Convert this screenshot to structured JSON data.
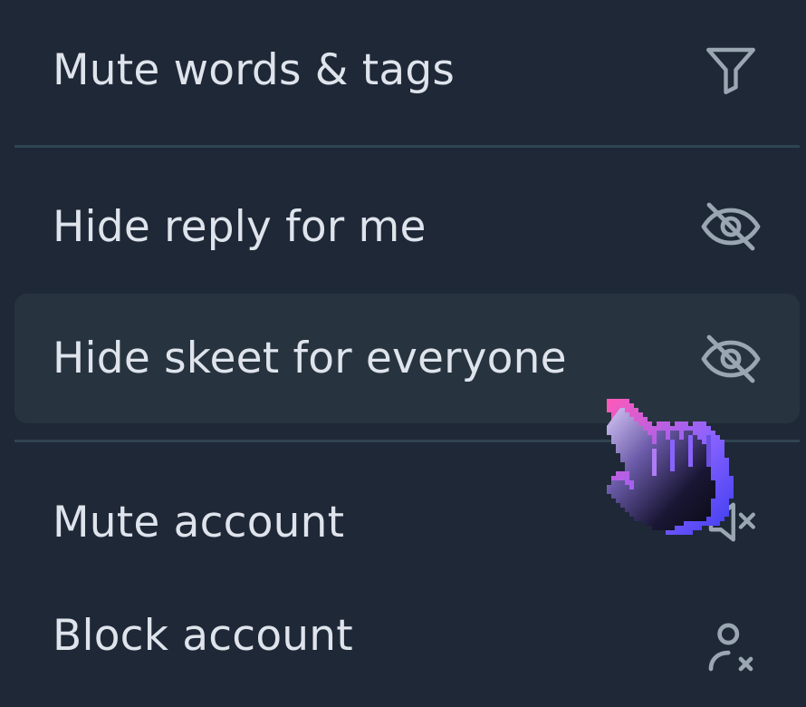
{
  "menu": {
    "items": [
      {
        "label": "Mute words & tags",
        "icon": "filter-icon"
      },
      {
        "label": "Hide reply for me",
        "icon": "eye-slash-icon"
      },
      {
        "label": "Hide skeet for everyone",
        "icon": "eye-slash-icon",
        "highlighted": true
      },
      {
        "label": "Mute account",
        "icon": "speaker-mute-icon"
      },
      {
        "label": "Block account",
        "icon": "person-x-icon"
      }
    ]
  },
  "colors": {
    "background": "#1f2837",
    "highlight": "#27343f",
    "separator": "#2f4451",
    "text": "#dfe4ec",
    "icon": "#9aa6b2",
    "cursor_gradient": [
      "#ff5ab9",
      "#8a63ff",
      "#3b3cf0"
    ]
  }
}
